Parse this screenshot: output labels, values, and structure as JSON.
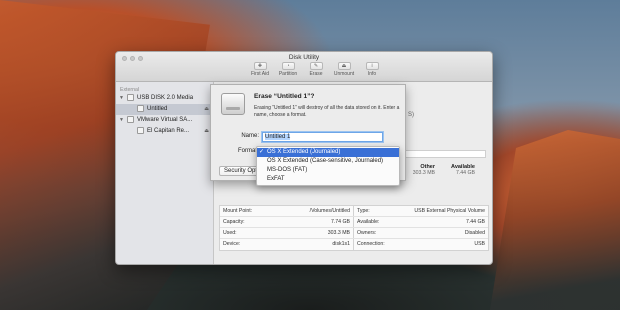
{
  "window": {
    "title": "Disk Utility"
  },
  "toolbar": [
    {
      "label": "First Aid",
      "icon": "stethoscope-icon"
    },
    {
      "label": "Partition",
      "icon": "pie-chart-icon"
    },
    {
      "label": "Erase",
      "icon": "eraser-icon"
    },
    {
      "label": "Unmount",
      "icon": "eject-icon"
    },
    {
      "label": "Info",
      "icon": "info-icon"
    }
  ],
  "sidebar": {
    "section": "External",
    "items": [
      {
        "label": "USB DISK 2.0 Media",
        "tri": "▼"
      },
      {
        "label": "Untitled",
        "eject": "⏏"
      },
      {
        "label": "VMware Virtual SA...",
        "tri": "▼"
      },
      {
        "label": "El Capitan Re...",
        "eject": "⏏"
      }
    ]
  },
  "sheet": {
    "title": "Erase “Untitled 1”?",
    "description": "Erasing “Untitled 1” will destroy of all the data stored on it. Enter a name, choose a format.",
    "name_label": "Name:",
    "name_value": "Untitled 1",
    "format_label": "Format",
    "security_label": "Security Options..."
  },
  "format_menu": {
    "check": "✓",
    "options": [
      "OS X Extended (Journaled)",
      "OS X Extended (Case-sensitive, Journaled)",
      "MS-DOS (FAT)",
      "ExFAT"
    ],
    "selected": 0
  },
  "background_text": {
    "fragment": "S)"
  },
  "usage": {
    "fill": 0.04,
    "columns": [
      {
        "label": "Other",
        "value": "303.3 MB"
      },
      {
        "label": "Available",
        "value": "7.44 GB"
      }
    ]
  },
  "info": [
    {
      "k1": "Mount Point:",
      "v1": "/Volumes/Untitled",
      "k2": "Type:",
      "v2": "USB External Physical Volume"
    },
    {
      "k1": "Capacity:",
      "v1": "7.74 GB",
      "k2": "Available:",
      "v2": "7.44 GB"
    },
    {
      "k1": "Used:",
      "v1": "303.3 MB",
      "k2": "Owners:",
      "v2": "Disabled"
    },
    {
      "k1": "Device:",
      "v1": "disk1s1",
      "k2": "Connection:",
      "v2": "USB"
    }
  ],
  "colors": {
    "accent": "#3a70d6",
    "usage_bar": "#6f9fd8"
  }
}
